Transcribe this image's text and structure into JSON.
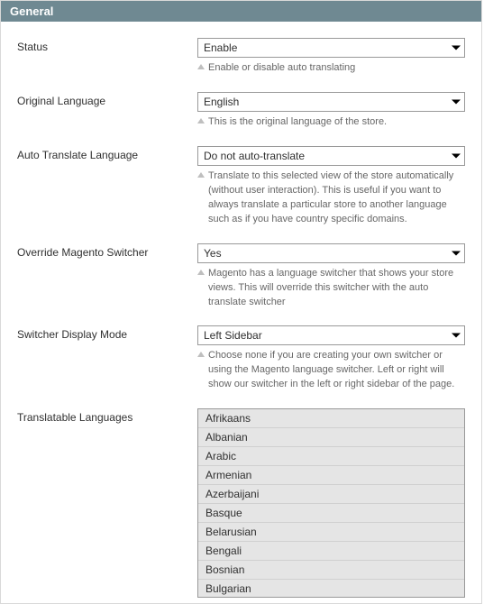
{
  "panel": {
    "title": "General"
  },
  "fields": {
    "status": {
      "label": "Status",
      "value": "Enable",
      "hint": "Enable or disable auto translating"
    },
    "original_language": {
      "label": "Original Language",
      "value": "English",
      "hint": "This is the original language of the store."
    },
    "auto_translate_language": {
      "label": "Auto Translate Language",
      "value": "Do not auto-translate",
      "hint": "Translate to this selected view of the store automatically (without user interaction). This is useful if you want to always translate a particular store to another language such as if you have country specific domains."
    },
    "override_switcher": {
      "label": "Override Magento Switcher",
      "value": "Yes",
      "hint": "Magento has a language switcher that shows your store views. This will override this switcher with the auto translate switcher"
    },
    "switcher_display_mode": {
      "label": "Switcher Display Mode",
      "value": "Left Sidebar",
      "hint": "Choose none if you are creating your own switcher or using the Magento language switcher. Left or right will show our switcher in the left or right sidebar of the page."
    },
    "translatable_languages": {
      "label": "Translatable Languages",
      "options": [
        "Afrikaans",
        "Albanian",
        "Arabic",
        "Armenian",
        "Azerbaijani",
        "Basque",
        "Belarusian",
        "Bengali",
        "Bosnian",
        "Bulgarian"
      ]
    }
  }
}
